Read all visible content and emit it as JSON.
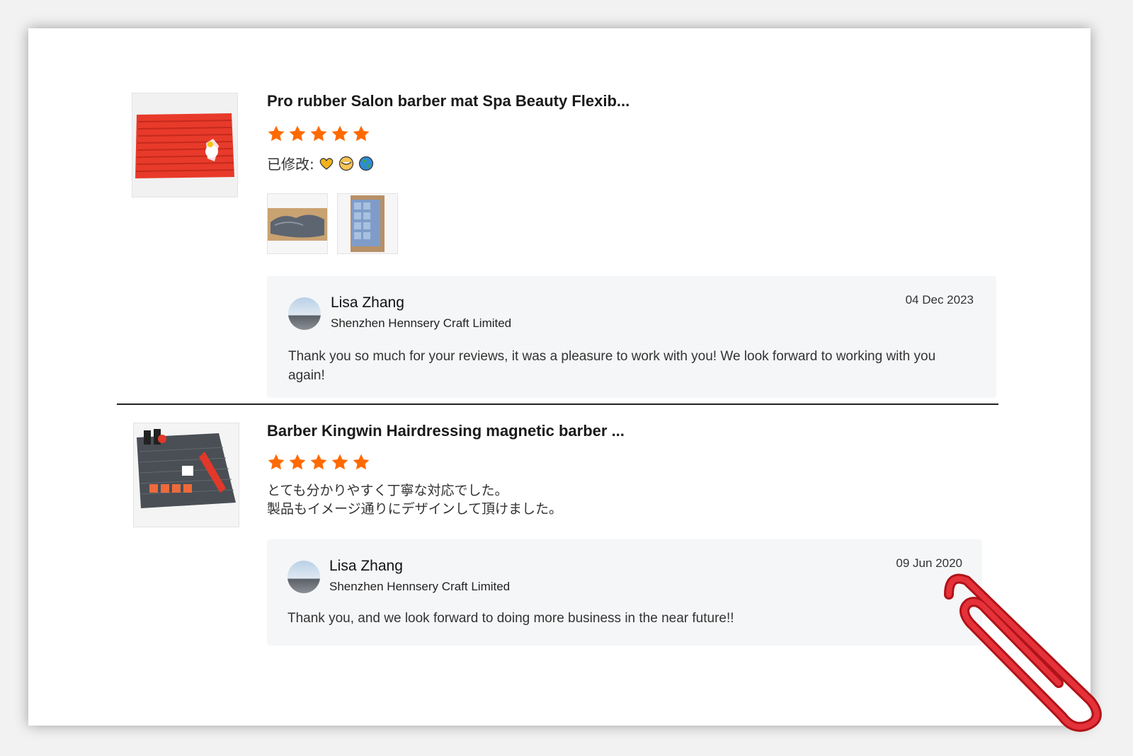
{
  "reviews": [
    {
      "product_title": "Pro rubber Salon barber mat Spa Beauty Flexib...",
      "rating": 5,
      "modified_label": "已修改:",
      "modified_icons": [
        "heart-emoji-icon",
        "smile-emoji-icon",
        "globe-emoji-icon"
      ],
      "photo_count": 2,
      "reply": {
        "name": "Lisa Zhang",
        "company": "Shenzhen Hennsery Craft Limited",
        "date": "04 Dec 2023",
        "text": "Thank you so much for your reviews, it was a pleasure to work with you! We look forward to working with you again!"
      }
    },
    {
      "product_title": "Barber Kingwin Hairdressing magnetic barber ...",
      "rating": 5,
      "comment_line1": "とても分かりやすく丁寧な対応でした。",
      "comment_line2": "製品もイメージ通りにデザインして頂けました。",
      "reply": {
        "name": "Lisa Zhang",
        "company": "Shenzhen Hennsery Craft Limited",
        "date": "09 Jun 2020",
        "text": "Thank you, and we look forward to doing more business in the near future!!"
      }
    }
  ],
  "colors": {
    "star": "#ff6a00",
    "reply_bg": "#f5f6f8",
    "clip": "#d81f26"
  }
}
